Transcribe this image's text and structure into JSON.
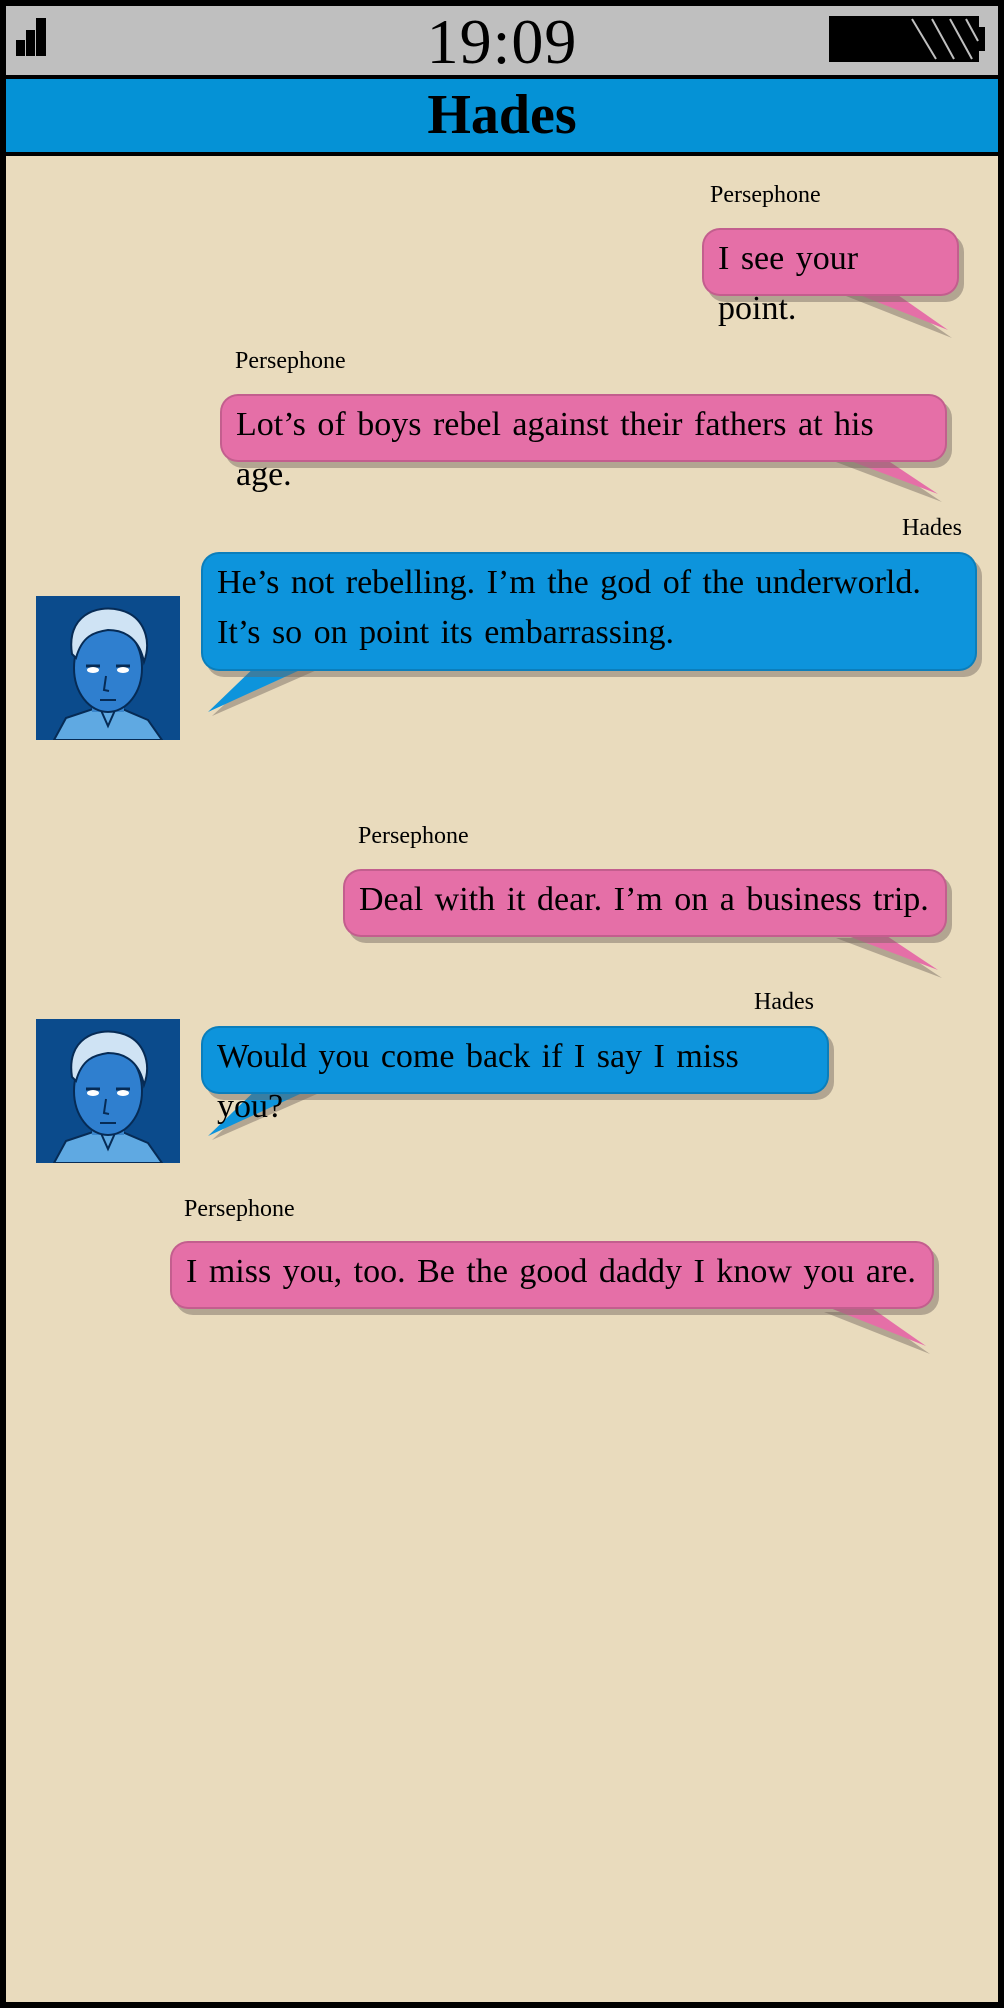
{
  "status_bar": {
    "time": "19:09",
    "signal_icon": "signal-bars-icon",
    "battery_icon": "battery-icon"
  },
  "header": {
    "title": "Hades"
  },
  "colors": {
    "background": "#e9dbbd",
    "header": "#0592d6",
    "status_bar": "#bfbfbf",
    "outgoing_bubble": "#e56fa7",
    "incoming_bubble": "#0d94dc"
  },
  "messages": [
    {
      "sender": "Persephone",
      "text": "I see your point.",
      "side": "right"
    },
    {
      "sender": "Persephone",
      "text": "Lot’s of boys rebel against their fathers at his age.",
      "side": "right"
    },
    {
      "sender": "Hades",
      "text": "He’s not rebelling. I’m the god of the underworld. It’s so on point its embarrassing.",
      "side": "left",
      "avatar": "hades-avatar"
    },
    {
      "sender": "Persephone",
      "text": "Deal with it dear. I’m on a business trip.",
      "side": "right"
    },
    {
      "sender": "Hades",
      "text": "Would you come back if I say I miss you?",
      "side": "left",
      "avatar": "hades-avatar"
    },
    {
      "sender": "Persephone",
      "text": "I miss you, too. Be the good daddy I know you are.",
      "side": "right"
    }
  ]
}
